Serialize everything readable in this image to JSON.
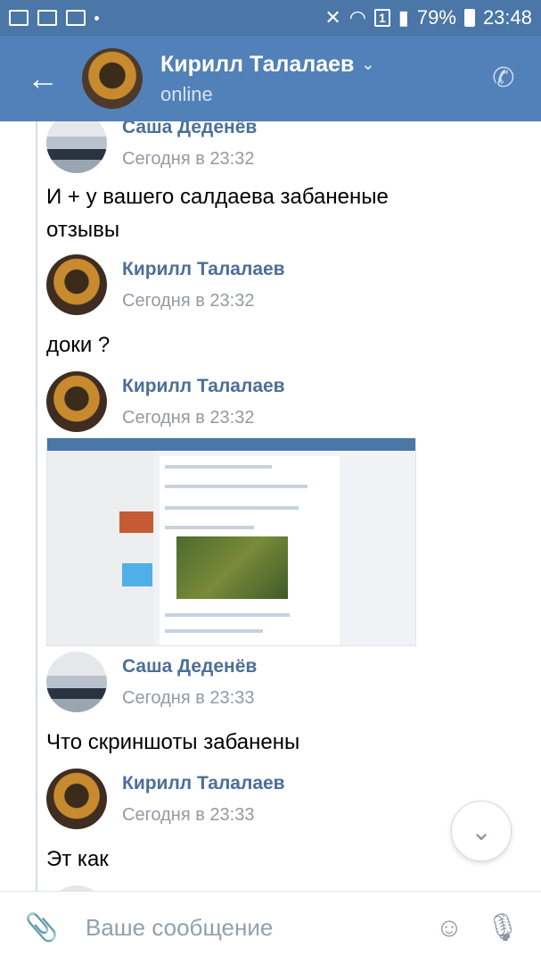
{
  "statusbar": {
    "battery": "79%",
    "time": "23:48",
    "sim": "1"
  },
  "header": {
    "contact_name": "Кирилл Талалаев",
    "status": "online"
  },
  "messages": [
    {
      "author": "Саша Деденёв",
      "time": "Сегодня в 23:32",
      "text": "И + у вашего салдаева забаненые отзывы"
    },
    {
      "author": "Кирилл Талалаев",
      "time": "Сегодня в 23:32",
      "text": "доки ?"
    },
    {
      "author": "Кирилл Талалаев",
      "time": "Сегодня в 23:32",
      "text": ""
    },
    {
      "author": "Саша Деденёв",
      "time": "Сегодня в 23:33",
      "text": "Что скриншоты забанены"
    },
    {
      "author": "Кирилл Талалаев",
      "time": "Сегодня в 23:33",
      "text": "Эт как"
    }
  ],
  "composer": {
    "placeholder": "Ваше сообщение"
  },
  "icons": {
    "back": "arrow-left-icon",
    "call": "phone-icon",
    "attach": "paperclip-icon",
    "emoji": "smile-icon",
    "mic": "microphone-icon",
    "scroll_down": "chevron-down-icon"
  }
}
